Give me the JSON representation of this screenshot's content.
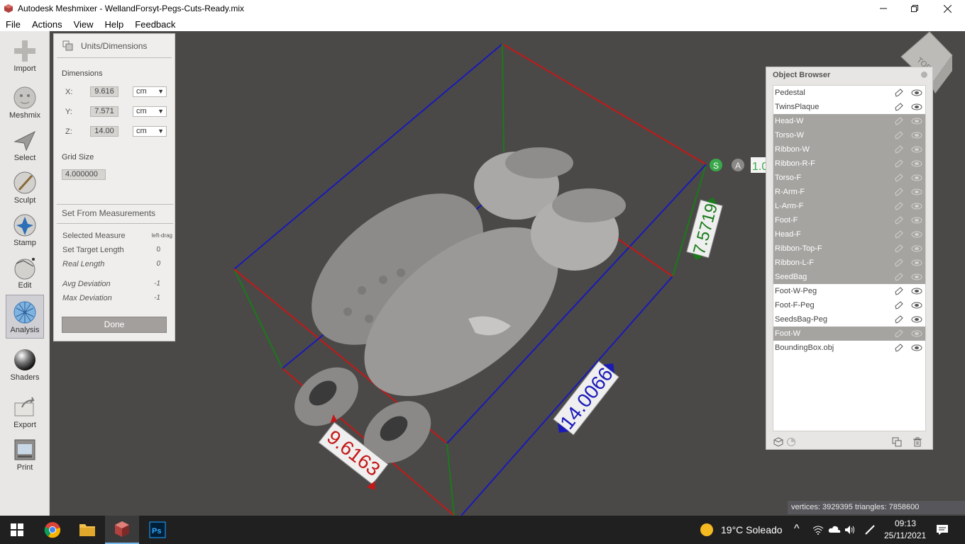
{
  "window": {
    "title": "Autodesk Meshmixer - WellandForsyt-Pegs-Cuts-Ready.mix"
  },
  "menu": [
    "File",
    "Actions",
    "View",
    "Help",
    "Feedback"
  ],
  "tools": [
    {
      "label": "Import",
      "icon": "import-icon"
    },
    {
      "label": "Meshmix",
      "icon": "meshmix-icon"
    },
    {
      "label": "Select",
      "icon": "select-icon"
    },
    {
      "label": "Sculpt",
      "icon": "sculpt-icon"
    },
    {
      "label": "Stamp",
      "icon": "stamp-icon"
    },
    {
      "label": "Edit",
      "icon": "edit-icon"
    },
    {
      "label": "Analysis",
      "icon": "analysis-icon",
      "active": true
    },
    {
      "label": "Shaders",
      "icon": "shaders-icon"
    },
    {
      "label": "Export",
      "icon": "export-icon"
    },
    {
      "label": "Print",
      "icon": "print-icon"
    }
  ],
  "units_panel": {
    "title": "Units/Dimensions",
    "dimensions_label": "Dimensions",
    "x_label": "X:",
    "x_value": "9.616",
    "x_unit": "cm",
    "y_label": "Y:",
    "y_value": "7.571",
    "y_unit": "cm",
    "z_label": "Z:",
    "z_value": "14.00",
    "z_unit": "cm",
    "grid_size_label": "Grid Size",
    "grid_size_value": "4.000000",
    "set_from_label": "Set From Measurements",
    "selected_measure_label": "Selected Measure",
    "selected_measure_value": "left-drag",
    "target_length_label": "Set Target Length",
    "target_length_value": "0",
    "real_length_label": "Real Length",
    "real_length_value": "0",
    "avg_dev_label": "Avg Deviation",
    "avg_dev_value": "-1",
    "max_dev_label": "Max Deviation",
    "max_dev_value": "-1",
    "done_label": "Done"
  },
  "viewport": {
    "measure_x": "9.6163",
    "measure_y": "7.5719",
    "measure_z": "14.0066",
    "gizmo_s": "S",
    "gizmo_a": "A",
    "gizmo_value": "1.0",
    "view_cube_face": "TOP"
  },
  "object_browser": {
    "title": "Object Browser",
    "items": [
      {
        "name": "Pedestal",
        "selected": false
      },
      {
        "name": "TwinsPlaque",
        "selected": false
      },
      {
        "name": "Head-W",
        "selected": true
      },
      {
        "name": "Torso-W",
        "selected": true
      },
      {
        "name": "Ribbon-W",
        "selected": true
      },
      {
        "name": "Ribbon-R-F",
        "selected": true
      },
      {
        "name": "Torso-F",
        "selected": true
      },
      {
        "name": "R-Arm-F",
        "selected": true
      },
      {
        "name": "L-Arm-F",
        "selected": true
      },
      {
        "name": "Foot-F",
        "selected": true
      },
      {
        "name": "Head-F",
        "selected": true
      },
      {
        "name": "Ribbon-Top-F",
        "selected": true
      },
      {
        "name": "Ribbon-L-F",
        "selected": true
      },
      {
        "name": "SeedBag",
        "selected": true
      },
      {
        "name": "Foot-W-Peg",
        "selected": false
      },
      {
        "name": "Foot-F-Peg",
        "selected": false
      },
      {
        "name": "SeedsBag-Peg",
        "selected": false
      },
      {
        "name": "Foot-W",
        "selected": true
      },
      {
        "name": "BoundingBox.obj",
        "selected": false
      }
    ]
  },
  "status": {
    "text": "vertices: 3929395 triangles: 7858600"
  },
  "taskbar": {
    "weather": "19°C  Soleado",
    "time": "09:13",
    "date": "25/11/2021"
  }
}
